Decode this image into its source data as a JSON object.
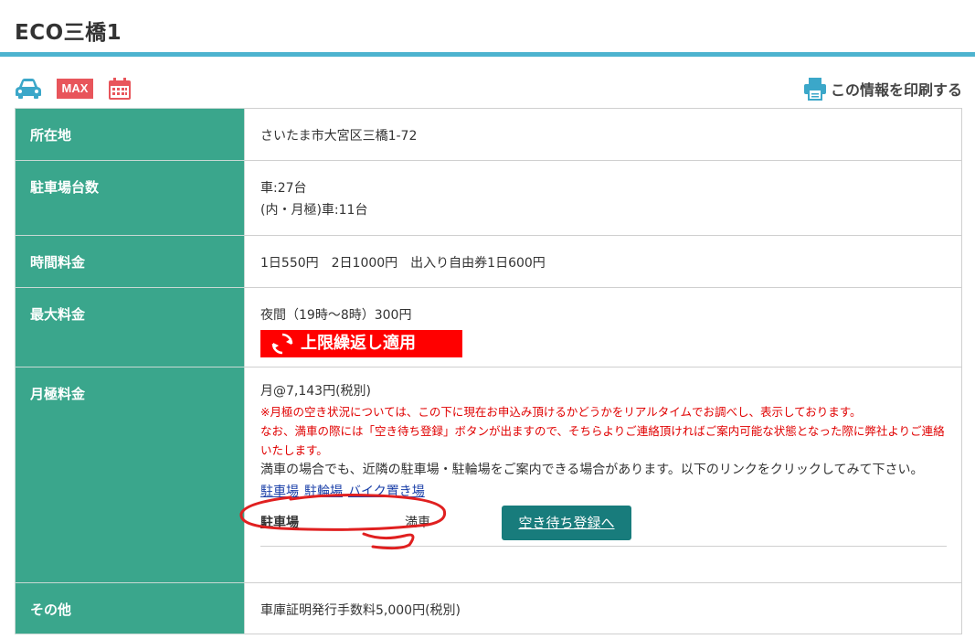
{
  "page_title": "ECO三橋1",
  "icons": {
    "car": "car-icon",
    "max": {
      "label": "MAX"
    },
    "calendar": "calendar-icon"
  },
  "print_label": "この情報を印刷する",
  "rows": {
    "location": {
      "label": "所在地",
      "value": "さいたま市大宮区三橋1-72"
    },
    "capacity": {
      "label": "駐車場台数",
      "line1": "車:27台",
      "line2": "(内・月極)車:11台"
    },
    "hourly": {
      "label": "時間料金",
      "value": "1日550円　2日1000円　出入り自由券1日600円"
    },
    "max": {
      "label": "最大料金",
      "value": "夜間（19時～8時）300円",
      "badge": "上限繰返し適用"
    },
    "monthly": {
      "label": "月極料金",
      "price": "月@7,143円(税別)",
      "note1": "※月極の空き状況については、この下に現在お申込み頂けるかどうかをリアルタイムでお調べし、表示しております。",
      "note2": "なお、満車の際には「空き待ち登録」ボタンが出ますので、そちらよりご連絡頂ければご案内可能な状態となった際に弊社よりご連絡いたします。",
      "info": "満車の場合でも、近隣の駐車場・駐輪場をご案内できる場合があります。以下のリンクをクリックしてみて下さい。",
      "links": [
        "駐車場",
        "駐輪場",
        "バイク置き場"
      ],
      "status_label": "駐車場",
      "status_value": "満車",
      "wait_button": "空き待ち登録へ"
    },
    "other": {
      "label": "その他",
      "value": "車庫証明発行手数料5,000円(税別)"
    }
  },
  "colors": {
    "header_green": "#3aa68c",
    "accent_blue": "#4db3cf",
    "badge_red": "#ff0000",
    "button_teal": "#187c7c",
    "link_blue": "#1a3fa8",
    "note_red": "#e00000"
  }
}
